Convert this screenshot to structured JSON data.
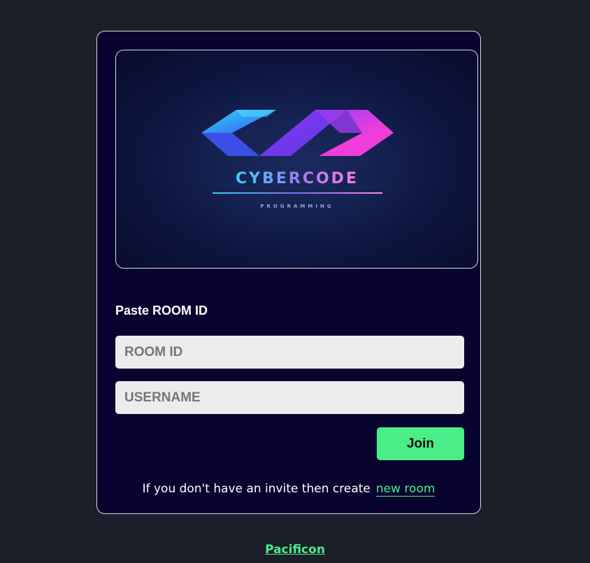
{
  "logo": {
    "title": "CYBERCODE",
    "subtitle": "PROGRAMMING"
  },
  "form": {
    "title": "Paste ROOM ID",
    "room_id_placeholder": "ROOM ID",
    "username_placeholder": "USERNAME",
    "join_label": "Join"
  },
  "invite": {
    "text": "If you don't have an invite then create",
    "link_label": "new room"
  },
  "footer": {
    "link_label": "Pacificon"
  },
  "colors": {
    "page_bg": "#1c1e29",
    "card_bg": "#090330",
    "accent": "#4aed88"
  }
}
